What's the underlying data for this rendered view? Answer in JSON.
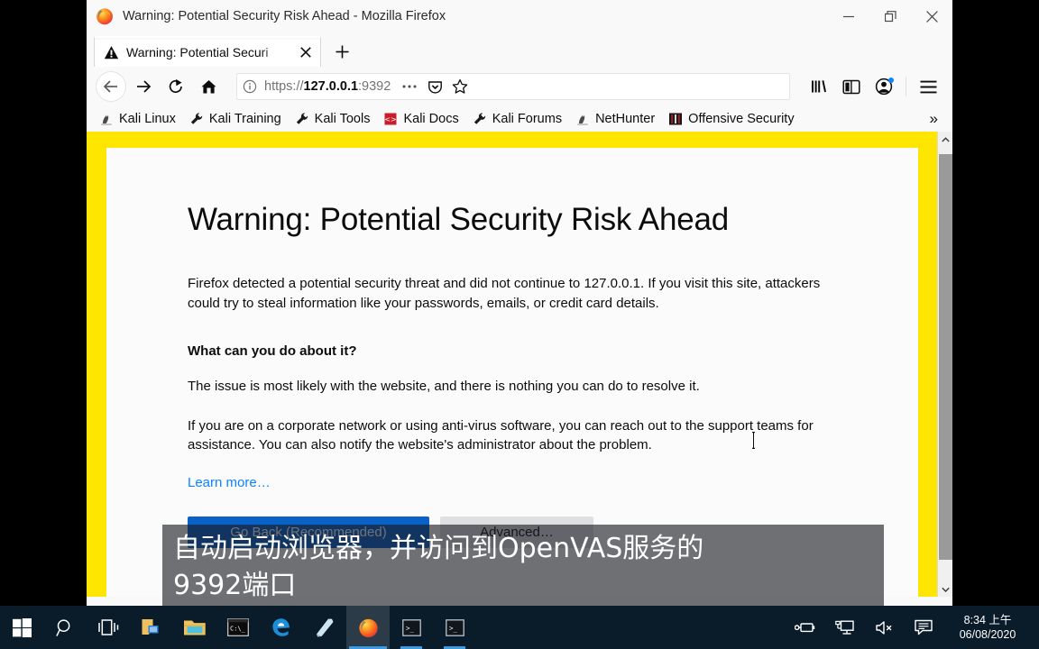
{
  "window": {
    "title": "Warning: Potential Security Risk Ahead - Mozilla Firefox",
    "logo_icon": "firefox-logo",
    "controls": {
      "minimize": "minimize-icon",
      "restore": "restore-icon",
      "close": "close-icon"
    }
  },
  "tabs": {
    "active": {
      "label": "Warning: Potential Securi",
      "icon": "warning-triangle-icon",
      "close_icon": "close-icon"
    },
    "new_tab_icon": "plus-icon"
  },
  "navbar": {
    "back_icon": "arrow-left-icon",
    "forward_icon": "arrow-right-icon",
    "reload_icon": "reload-icon",
    "home_icon": "home-icon",
    "urlbar": {
      "identity_icon": "info-circle-icon",
      "scheme": "https://",
      "host": "127.0.0.1",
      "port": ":9392",
      "full_url": "https://127.0.0.1:9392",
      "page_actions_icon": "ellipsis-icon",
      "pocket_icon": "pocket-icon",
      "bookmark_star_icon": "star-icon"
    },
    "library_icon": "library-icon",
    "sidebar_icon": "sidebar-icon",
    "account_icon": "account-avatar-icon",
    "menu_icon": "hamburger-menu-icon"
  },
  "bookmarks": {
    "items": [
      {
        "label": "Kali Linux",
        "icon": "kali-dragon-icon"
      },
      {
        "label": "Kali Training",
        "icon": "wrench-icon"
      },
      {
        "label": "Kali Tools",
        "icon": "wrench-icon"
      },
      {
        "label": "Kali Docs",
        "icon": "kali-docs-icon"
      },
      {
        "label": "Kali Forums",
        "icon": "wrench-icon"
      },
      {
        "label": "NetHunter",
        "icon": "kali-dragon-icon"
      },
      {
        "label": "Offensive Security",
        "icon": "offsec-icon"
      }
    ],
    "overflow_label": "»",
    "overflow_icon": "chevron-double-right-icon"
  },
  "page": {
    "title": "Warning: Potential Security Risk Ahead",
    "paragraph1": "Firefox detected a potential security threat and did not continue to 127.0.0.1. If you visit this site, attackers could try to steal information like your passwords, emails, or credit card details.",
    "subheading": "What can you do about it?",
    "paragraph2": "The issue is most likely with the website, and there is nothing you can do to resolve it.",
    "paragraph3": "If you are on a corporate network or using anti-virus software, you can reach out to the support teams for assistance. You can also notify the website's administrator about the problem.",
    "learn_more": "Learn more…",
    "buttons": {
      "primary": "Go Back (Recommended)",
      "secondary": "Advanced…"
    },
    "scrollbar": {
      "up_icon": "chevron-up-icon",
      "down_icon": "chevron-down-icon"
    }
  },
  "overlay": {
    "subtitle_line1": "自动启动浏览器，并访问到OpenVAS服务的",
    "subtitle_line2": "9392端口"
  },
  "taskbar": {
    "items": [
      {
        "name": "start-button",
        "icon": "windows-logo-icon"
      },
      {
        "name": "search-button",
        "icon": "search-icon"
      },
      {
        "name": "task-view-button",
        "icon": "task-view-icon"
      },
      {
        "name": "store-button",
        "icon": "store-icon"
      },
      {
        "name": "file-explorer-button",
        "icon": "folder-icon"
      },
      {
        "name": "command-prompt",
        "icon": "cmd-icon"
      },
      {
        "name": "edge-browser",
        "icon": "edge-icon"
      },
      {
        "name": "sticky-notes",
        "icon": "sticky-notes-icon"
      },
      {
        "name": "firefox-browser",
        "icon": "firefox-logo"
      },
      {
        "name": "terminal-window-1",
        "icon": "terminal-icon"
      },
      {
        "name": "terminal-window-2",
        "icon": "terminal-icon"
      }
    ],
    "tray": [
      {
        "name": "battery-status",
        "icon": "battery-plug-icon"
      },
      {
        "name": "network-status",
        "icon": "network-monitor-icon"
      },
      {
        "name": "volume-status",
        "icon": "speaker-muted-icon"
      },
      {
        "name": "action-center",
        "icon": "notification-icon"
      }
    ],
    "clock": {
      "time": "8:34 上午",
      "date": "06/08/2020"
    }
  },
  "colors": {
    "recording_border": "#ffe600",
    "primary_button": "#0a62c7",
    "link": "#0a84ff",
    "taskbar": "#0a1b2a",
    "chrome": "#f9f9fa"
  }
}
